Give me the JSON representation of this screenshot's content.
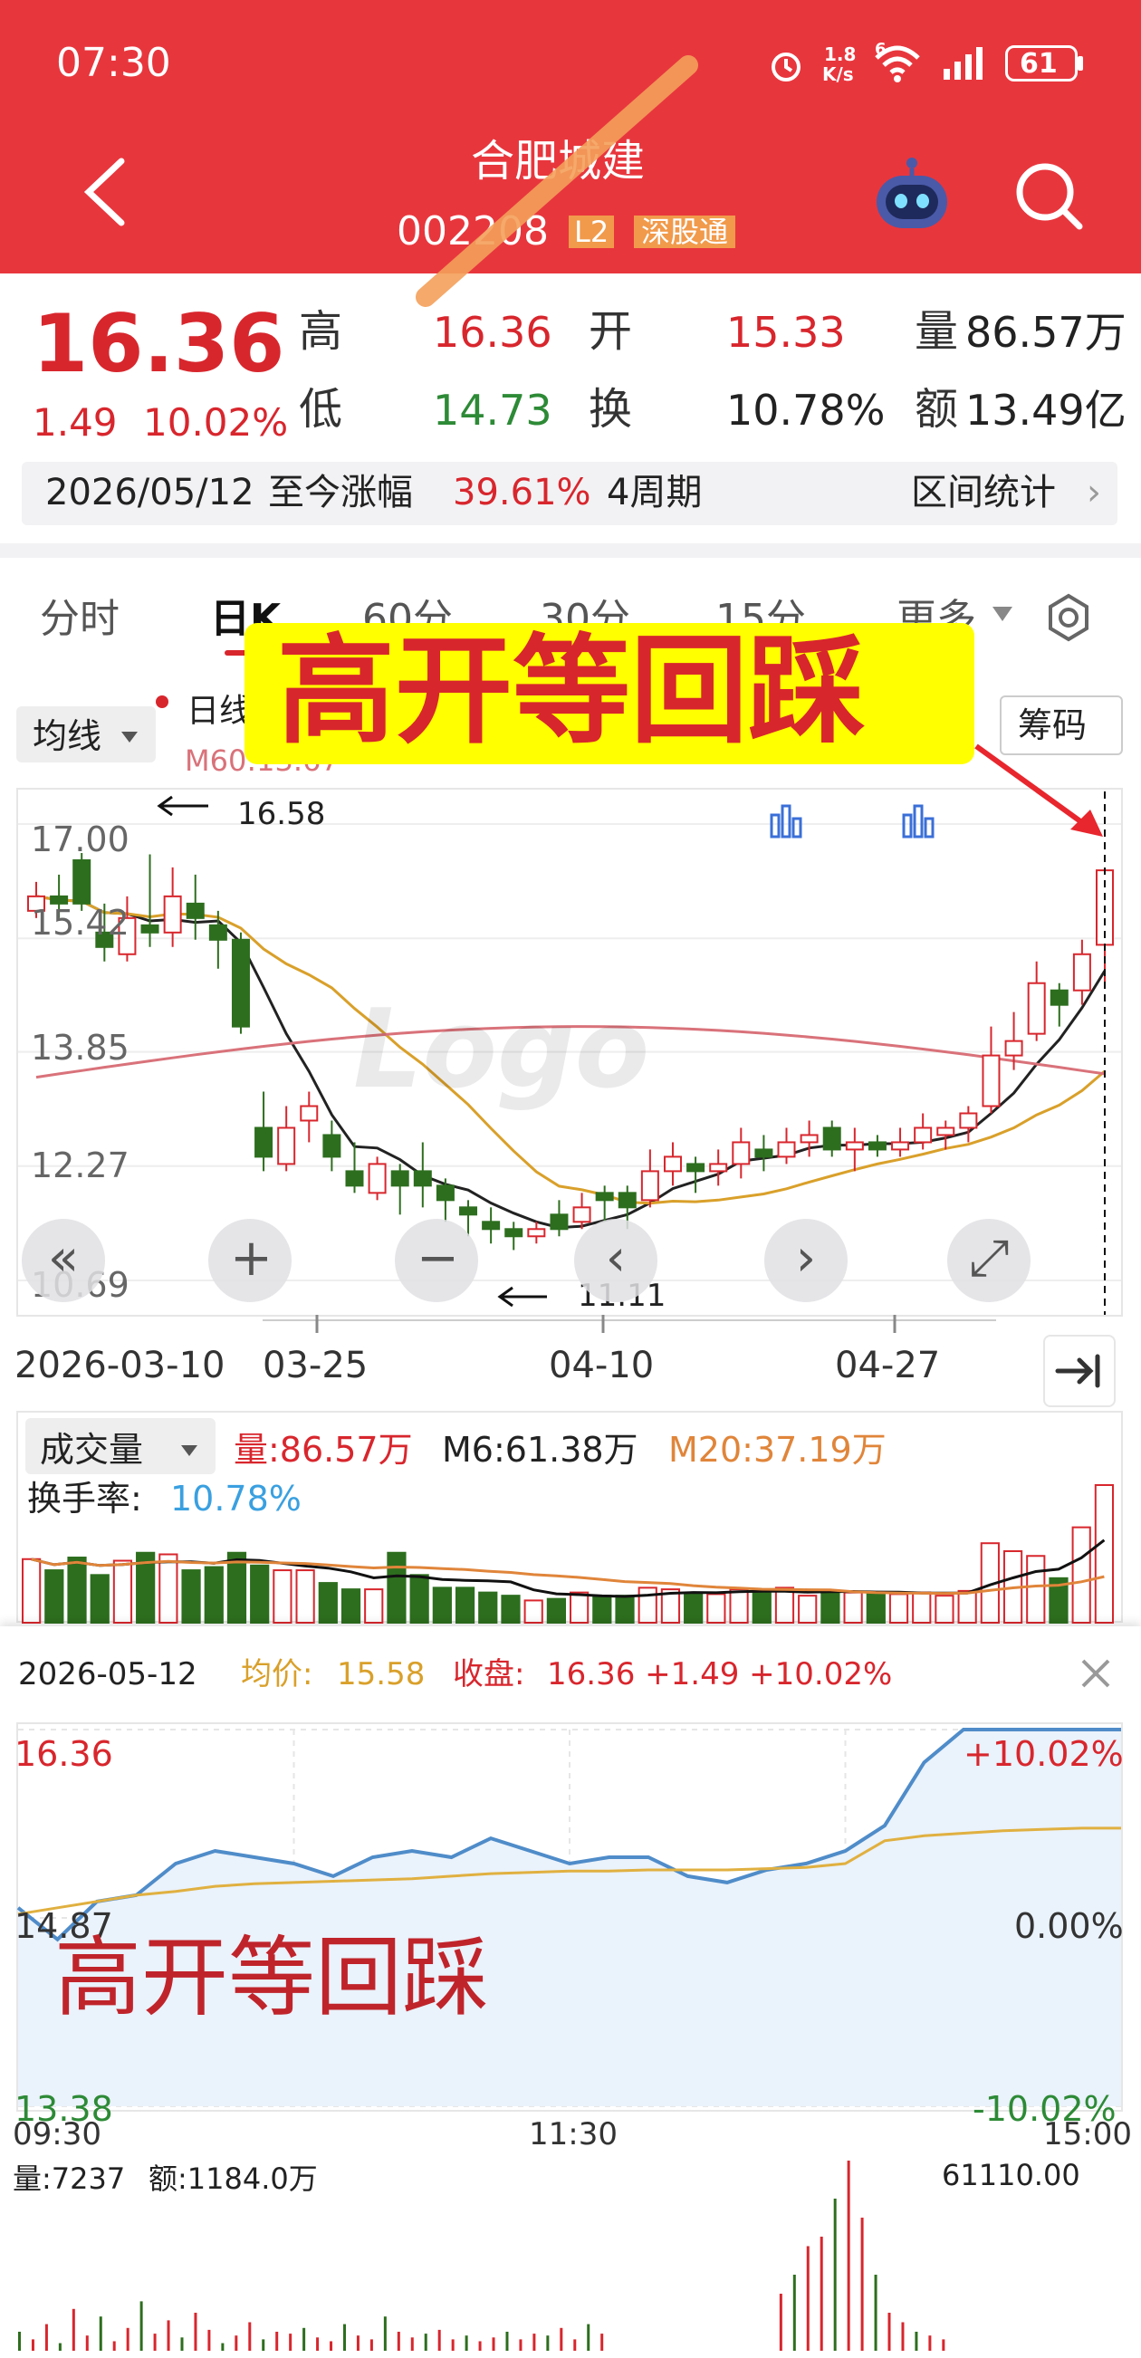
{
  "status_bar": {
    "time": "07:30",
    "net_speed_value": "1.8",
    "net_speed_unit": "K/s",
    "wifi_badge": "6",
    "battery": "61"
  },
  "header": {
    "title": "合肥城建",
    "code": "002208",
    "badge_l2": "L2",
    "badge_connect": "深股通"
  },
  "quote": {
    "price": "16.36",
    "change": "1.49",
    "change_pct": "10.02%",
    "stats": [
      {
        "label": "高",
        "value": "16.36",
        "tone": "red"
      },
      {
        "label": "开",
        "value": "15.33",
        "tone": "red"
      },
      {
        "label": "量",
        "value": "86.57万",
        "tone": "dark"
      },
      {
        "label": "低",
        "value": "14.73",
        "tone": "green"
      },
      {
        "label": "换",
        "value": "10.78%",
        "tone": "dark"
      },
      {
        "label": "额",
        "value": "13.49亿",
        "tone": "dark"
      }
    ],
    "range_date": "2026/05/12",
    "range_label": "至今涨幅",
    "range_pct": "39.61%",
    "range_period": "4周期",
    "range_stats": "区间统计"
  },
  "tabs": {
    "items": [
      "分时",
      "日K",
      "60分",
      "30分",
      "15分",
      "更多"
    ]
  },
  "indicators": {
    "ma_button": "均线",
    "ma_label": "日线",
    "ma60_label": "M60:13.67",
    "chip_button": "筹码"
  },
  "annotation": {
    "overlay_title": "高开等回踩",
    "chart_caption": "高开等回踩"
  },
  "kline": {
    "y_labels": [
      "17.00",
      "15.42",
      "13.85",
      "12.27",
      "10.69"
    ],
    "high_marker": "16.58",
    "low_marker": "11.11",
    "x_labels": [
      "2026-03-10",
      "03-25",
      "04-10",
      "04-27"
    ]
  },
  "volume": {
    "selector": "成交量",
    "vol_label": "量:86.57万",
    "m6_label": "M6:61.38万",
    "m20_label": "M20:37.19万",
    "turnover_label": "换手率:",
    "turnover_value": "10.78%"
  },
  "intraday": {
    "date": "2026-05-12",
    "avg_label": "均价:",
    "avg_value": "15.58",
    "close_label": "收盘:",
    "close_value": "16.36 +1.49 +10.02%",
    "left_labels": [
      "16.36",
      "14.87",
      "13.38"
    ],
    "right_labels": [
      "+10.02%",
      "0.00%",
      "-10.02%"
    ],
    "time_labels": [
      "09:30",
      "11:30",
      "15:00"
    ],
    "vol_label": "量:7237",
    "amount_label": "额:1184.0万",
    "max_vol": "61110.00"
  },
  "colors": {
    "header_red": "#e8363d",
    "up_red": "#d8262d",
    "down_green": "#2d6e1e",
    "ma5": "#222222",
    "ma20": "#d9a02a",
    "ma60": "#d9727a",
    "avg_line": "#e0b040",
    "price_line": "#4f8cc9",
    "overlay_yellow": "#ffff00",
    "accent_orange": "#f4a05a"
  },
  "chart_data": [
    {
      "type": "candlestick",
      "title": "日K",
      "y_range": [
        10.69,
        17.0
      ],
      "ma_lines": [
        "MA5",
        "MA20",
        "MA60"
      ],
      "candles": [
        [
          15.8,
          16.0,
          16.2,
          15.7
        ],
        [
          16.0,
          15.9,
          16.3,
          15.7
        ],
        [
          16.5,
          15.9,
          16.6,
          15.8
        ],
        [
          15.5,
          15.3,
          15.9,
          15.1
        ],
        [
          15.2,
          15.7,
          16.0,
          15.1
        ],
        [
          15.6,
          15.5,
          16.58,
          15.3
        ],
        [
          15.5,
          16.0,
          16.4,
          15.3
        ],
        [
          15.9,
          15.7,
          16.3,
          15.4
        ],
        [
          15.6,
          15.4,
          15.8,
          15.0
        ],
        [
          15.4,
          14.2,
          15.5,
          14.1
        ],
        [
          12.8,
          12.4,
          13.3,
          12.2
        ],
        [
          12.3,
          12.8,
          13.1,
          12.2
        ],
        [
          12.9,
          13.1,
          13.3,
          12.6
        ],
        [
          12.7,
          12.4,
          12.9,
          12.2
        ],
        [
          12.2,
          12.0,
          12.6,
          11.9
        ],
        [
          11.9,
          12.3,
          12.4,
          11.8
        ],
        [
          12.2,
          12.0,
          12.3,
          11.6
        ],
        [
          12.2,
          12.0,
          12.6,
          11.7
        ],
        [
          12.0,
          11.8,
          12.1,
          11.5
        ],
        [
          11.7,
          11.6,
          11.8,
          11.3
        ],
        [
          11.5,
          11.4,
          11.7,
          11.2
        ],
        [
          11.4,
          11.3,
          11.5,
          11.11
        ],
        [
          11.3,
          11.4,
          11.5,
          11.2
        ],
        [
          11.6,
          11.4,
          11.8,
          11.3
        ],
        [
          11.5,
          11.7,
          11.9,
          11.4
        ],
        [
          11.9,
          11.8,
          12.0,
          11.5
        ],
        [
          11.9,
          11.7,
          12.0,
          11.4
        ],
        [
          11.8,
          12.2,
          12.5,
          11.7
        ],
        [
          12.2,
          12.4,
          12.6,
          12.0
        ],
        [
          12.3,
          12.2,
          12.4,
          11.9
        ],
        [
          12.2,
          12.3,
          12.5,
          12.0
        ],
        [
          12.3,
          12.6,
          12.8,
          12.1
        ],
        [
          12.5,
          12.4,
          12.7,
          12.2
        ],
        [
          12.4,
          12.6,
          12.8,
          12.3
        ],
        [
          12.6,
          12.7,
          12.9,
          12.4
        ],
        [
          12.8,
          12.5,
          12.9,
          12.4
        ],
        [
          12.5,
          12.6,
          12.8,
          12.2
        ],
        [
          12.6,
          12.5,
          12.7,
          12.4
        ],
        [
          12.5,
          12.6,
          12.8,
          12.4
        ],
        [
          12.6,
          12.8,
          13.0,
          12.5
        ],
        [
          12.7,
          12.8,
          12.9,
          12.5
        ],
        [
          12.8,
          13.0,
          13.1,
          12.6
        ],
        [
          13.1,
          13.8,
          14.2,
          13.0
        ],
        [
          13.8,
          14.0,
          14.4,
          13.6
        ],
        [
          14.1,
          14.8,
          15.1,
          14.0
        ],
        [
          14.7,
          14.5,
          14.8,
          14.2
        ],
        [
          14.7,
          15.2,
          15.4,
          14.5
        ],
        [
          15.33,
          16.36,
          16.36,
          14.73
        ]
      ]
    },
    {
      "type": "bar",
      "title": "成交量",
      "series": [
        {
          "name": "成交量",
          "values": [
            40,
            33,
            41,
            30,
            39,
            44,
            43,
            33,
            35,
            44,
            36,
            33,
            33,
            25,
            21,
            21,
            44,
            30,
            22,
            22,
            19,
            17,
            14,
            15,
            19,
            17,
            17,
            22,
            21,
            18,
            18,
            21,
            19,
            22,
            17,
            20,
            19,
            19,
            18,
            19,
            17,
            20,
            50,
            45,
            42,
            28,
            60,
            86.57
          ]
        },
        {
          "name": "M6",
          "values": []
        },
        {
          "name": "M20",
          "values": []
        }
      ]
    },
    {
      "type": "line",
      "title": "分时",
      "y_range": [
        13.38,
        16.36
      ],
      "series": [
        {
          "name": "价格",
          "values": [
            14.95,
            14.7,
            15.0,
            15.05,
            15.3,
            15.4,
            15.35,
            15.3,
            15.2,
            15.35,
            15.4,
            15.35,
            15.5,
            15.4,
            15.3,
            15.35,
            15.35,
            15.2,
            15.15,
            15.25,
            15.3,
            15.4,
            15.6,
            16.1,
            16.36,
            16.36,
            16.36,
            16.36,
            16.36
          ]
        },
        {
          "name": "均价",
          "values": [
            14.9,
            14.95,
            15.0,
            15.05,
            15.08,
            15.12,
            15.14,
            15.15,
            15.16,
            15.17,
            15.18,
            15.2,
            15.22,
            15.23,
            15.24,
            15.24,
            15.25,
            15.25,
            15.25,
            15.26,
            15.27,
            15.3,
            15.48,
            15.52,
            15.54,
            15.56,
            15.57,
            15.58,
            15.58
          ]
        }
      ],
      "x_labels": [
        "09:30",
        "11:30",
        "15:00"
      ]
    }
  ]
}
